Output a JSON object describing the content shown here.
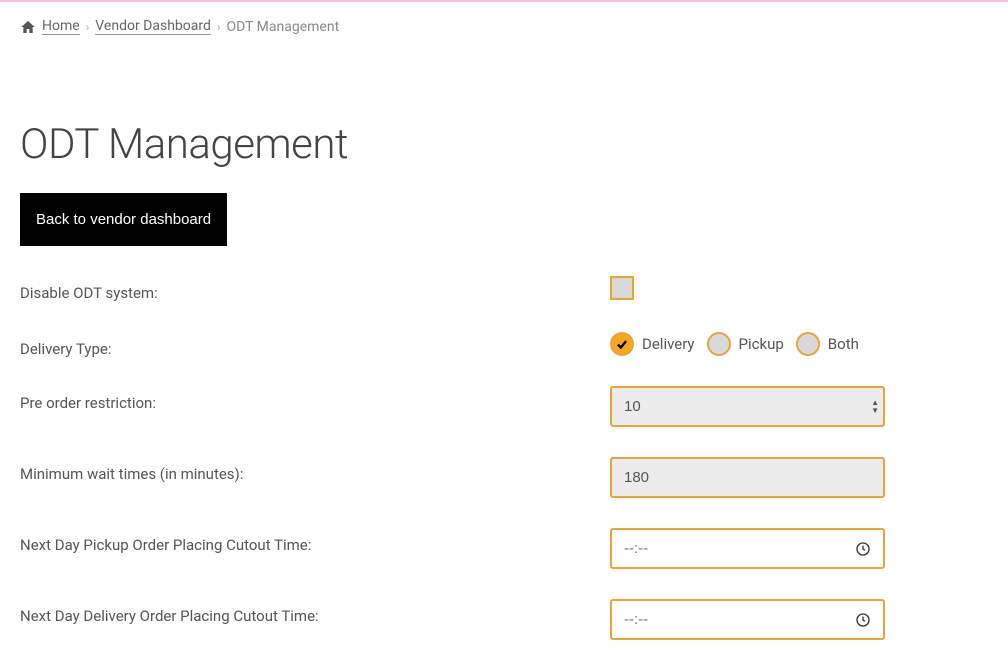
{
  "breadcrumb": {
    "home": "Home",
    "vendor_dashboard": "Vendor Dashboard",
    "current": "ODT Management"
  },
  "page_title": "ODT Management",
  "back_button": "Back to vendor dashboard",
  "form": {
    "disable_odt_label": "Disable ODT system:",
    "delivery_type_label": "Delivery Type:",
    "delivery_type_options": {
      "delivery": "Delivery",
      "pickup": "Pickup",
      "both": "Both"
    },
    "delivery_type_selected": "delivery",
    "pre_order_label": "Pre order restriction:",
    "pre_order_value": "10",
    "min_wait_label": "Minimum wait times (in minutes):",
    "min_wait_value": "180",
    "pickup_cutout_label": "Next Day Pickup Order Placing Cutout Time:",
    "pickup_cutout_placeholder": "--:--",
    "delivery_cutout_label": "Next Day Delivery Order Placing Cutout Time:",
    "delivery_cutout_placeholder": "--:--"
  }
}
